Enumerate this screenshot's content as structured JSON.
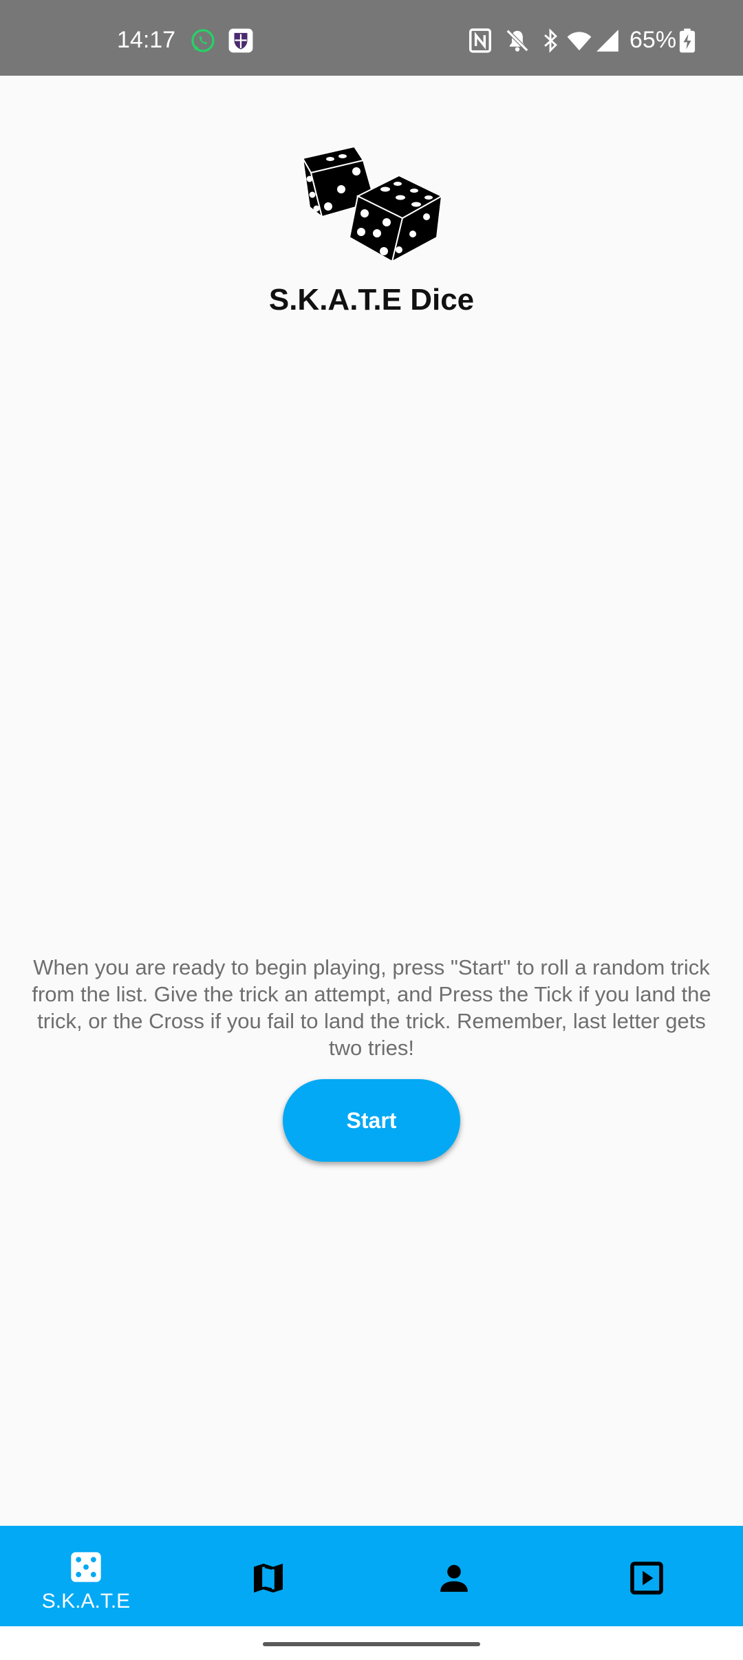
{
  "status_bar": {
    "time": "14:17",
    "battery": "65%",
    "icons": [
      "whatsapp-icon",
      "shield-app-icon",
      "nfc-icon",
      "mute-icon",
      "bluetooth-icon",
      "wifi-icon",
      "signal-icon",
      "battery-charging-icon"
    ]
  },
  "header": {
    "logo_icon": "dice-icon",
    "title": "S.K.A.T.E Dice"
  },
  "main": {
    "instructions": "When you are ready to begin playing, press \"Start\" to roll a random trick from the list. Give the trick an attempt, and Press the Tick if you land the trick, or the Cross if you fail to land the trick. Remember, last letter gets two tries!",
    "start_label": "Start"
  },
  "bottom_nav": {
    "items": [
      {
        "icon": "dice-icon",
        "label": "S.K.A.T.E",
        "active": true
      },
      {
        "icon": "map-icon",
        "label": ""
      },
      {
        "icon": "person-icon",
        "label": ""
      },
      {
        "icon": "play-box-icon",
        "label": ""
      }
    ]
  },
  "colors": {
    "accent": "#03a9f4",
    "background": "#fafafa",
    "status_bar": "#777777",
    "whatsapp": "#25d366"
  }
}
